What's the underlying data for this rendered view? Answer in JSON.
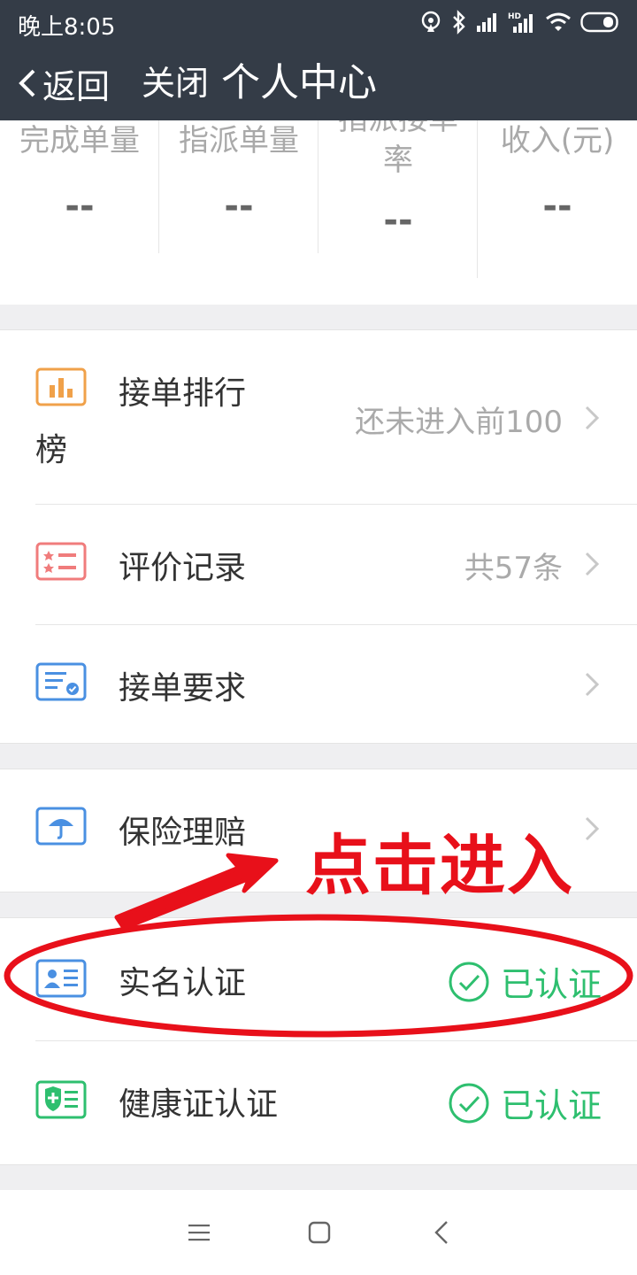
{
  "status_bar": {
    "time": "晚上8:05"
  },
  "navbar": {
    "back_label": "返回",
    "close_label": "关闭",
    "title": "个人中心"
  },
  "stats": [
    {
      "label": "完成单量",
      "value": "--"
    },
    {
      "label": "指派单量",
      "value": "--"
    },
    {
      "label_line1": "指派接单",
      "label_line2": "率",
      "value": "--"
    },
    {
      "label": "收入(元)",
      "value": "--"
    }
  ],
  "menu": {
    "ranking": {
      "label_line1": "接单排行",
      "label_line2": "榜",
      "value": "还未进入前100"
    },
    "reviews": {
      "label": "评价记录",
      "value": "共57条"
    },
    "requirements": {
      "label": "接单要求"
    },
    "insurance": {
      "label": "保险理赔"
    },
    "realname": {
      "label": "实名认证",
      "status": "已认证"
    },
    "health": {
      "label": "健康证认证",
      "status": "已认证"
    }
  },
  "annotation": {
    "text": "点击进入"
  },
  "colors": {
    "header": "#343c47",
    "green": "#2ebf6f",
    "red": "#e8101a",
    "orange": "#f0a14a",
    "pink": "#f07c7c",
    "blue": "#4a90e2"
  }
}
